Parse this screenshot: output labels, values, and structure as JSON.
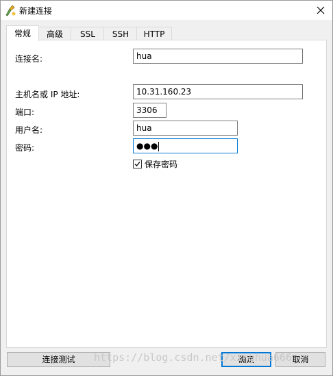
{
  "window": {
    "title": "新建连接"
  },
  "tabs": [
    {
      "label": "常规",
      "active": true
    },
    {
      "label": "高级"
    },
    {
      "label": "SSL"
    },
    {
      "label": "SSH"
    },
    {
      "label": "HTTP"
    }
  ],
  "form": {
    "connection_name": {
      "label": "连接名:",
      "value": "hua"
    },
    "host": {
      "label": "主机名或 IP 地址:",
      "value": "10.31.160.23"
    },
    "port": {
      "label": "端口:",
      "value": "3306"
    },
    "username": {
      "label": "用户名:",
      "value": "hua"
    },
    "password": {
      "label": "密码:",
      "value": "●●●"
    },
    "save_password": {
      "label": "保存密码",
      "checked": true
    }
  },
  "buttons": {
    "test": "连接测试",
    "ok": "确定",
    "cancel": "取消"
  },
  "watermark": "https://blog.csdn.net/xinghua666"
}
